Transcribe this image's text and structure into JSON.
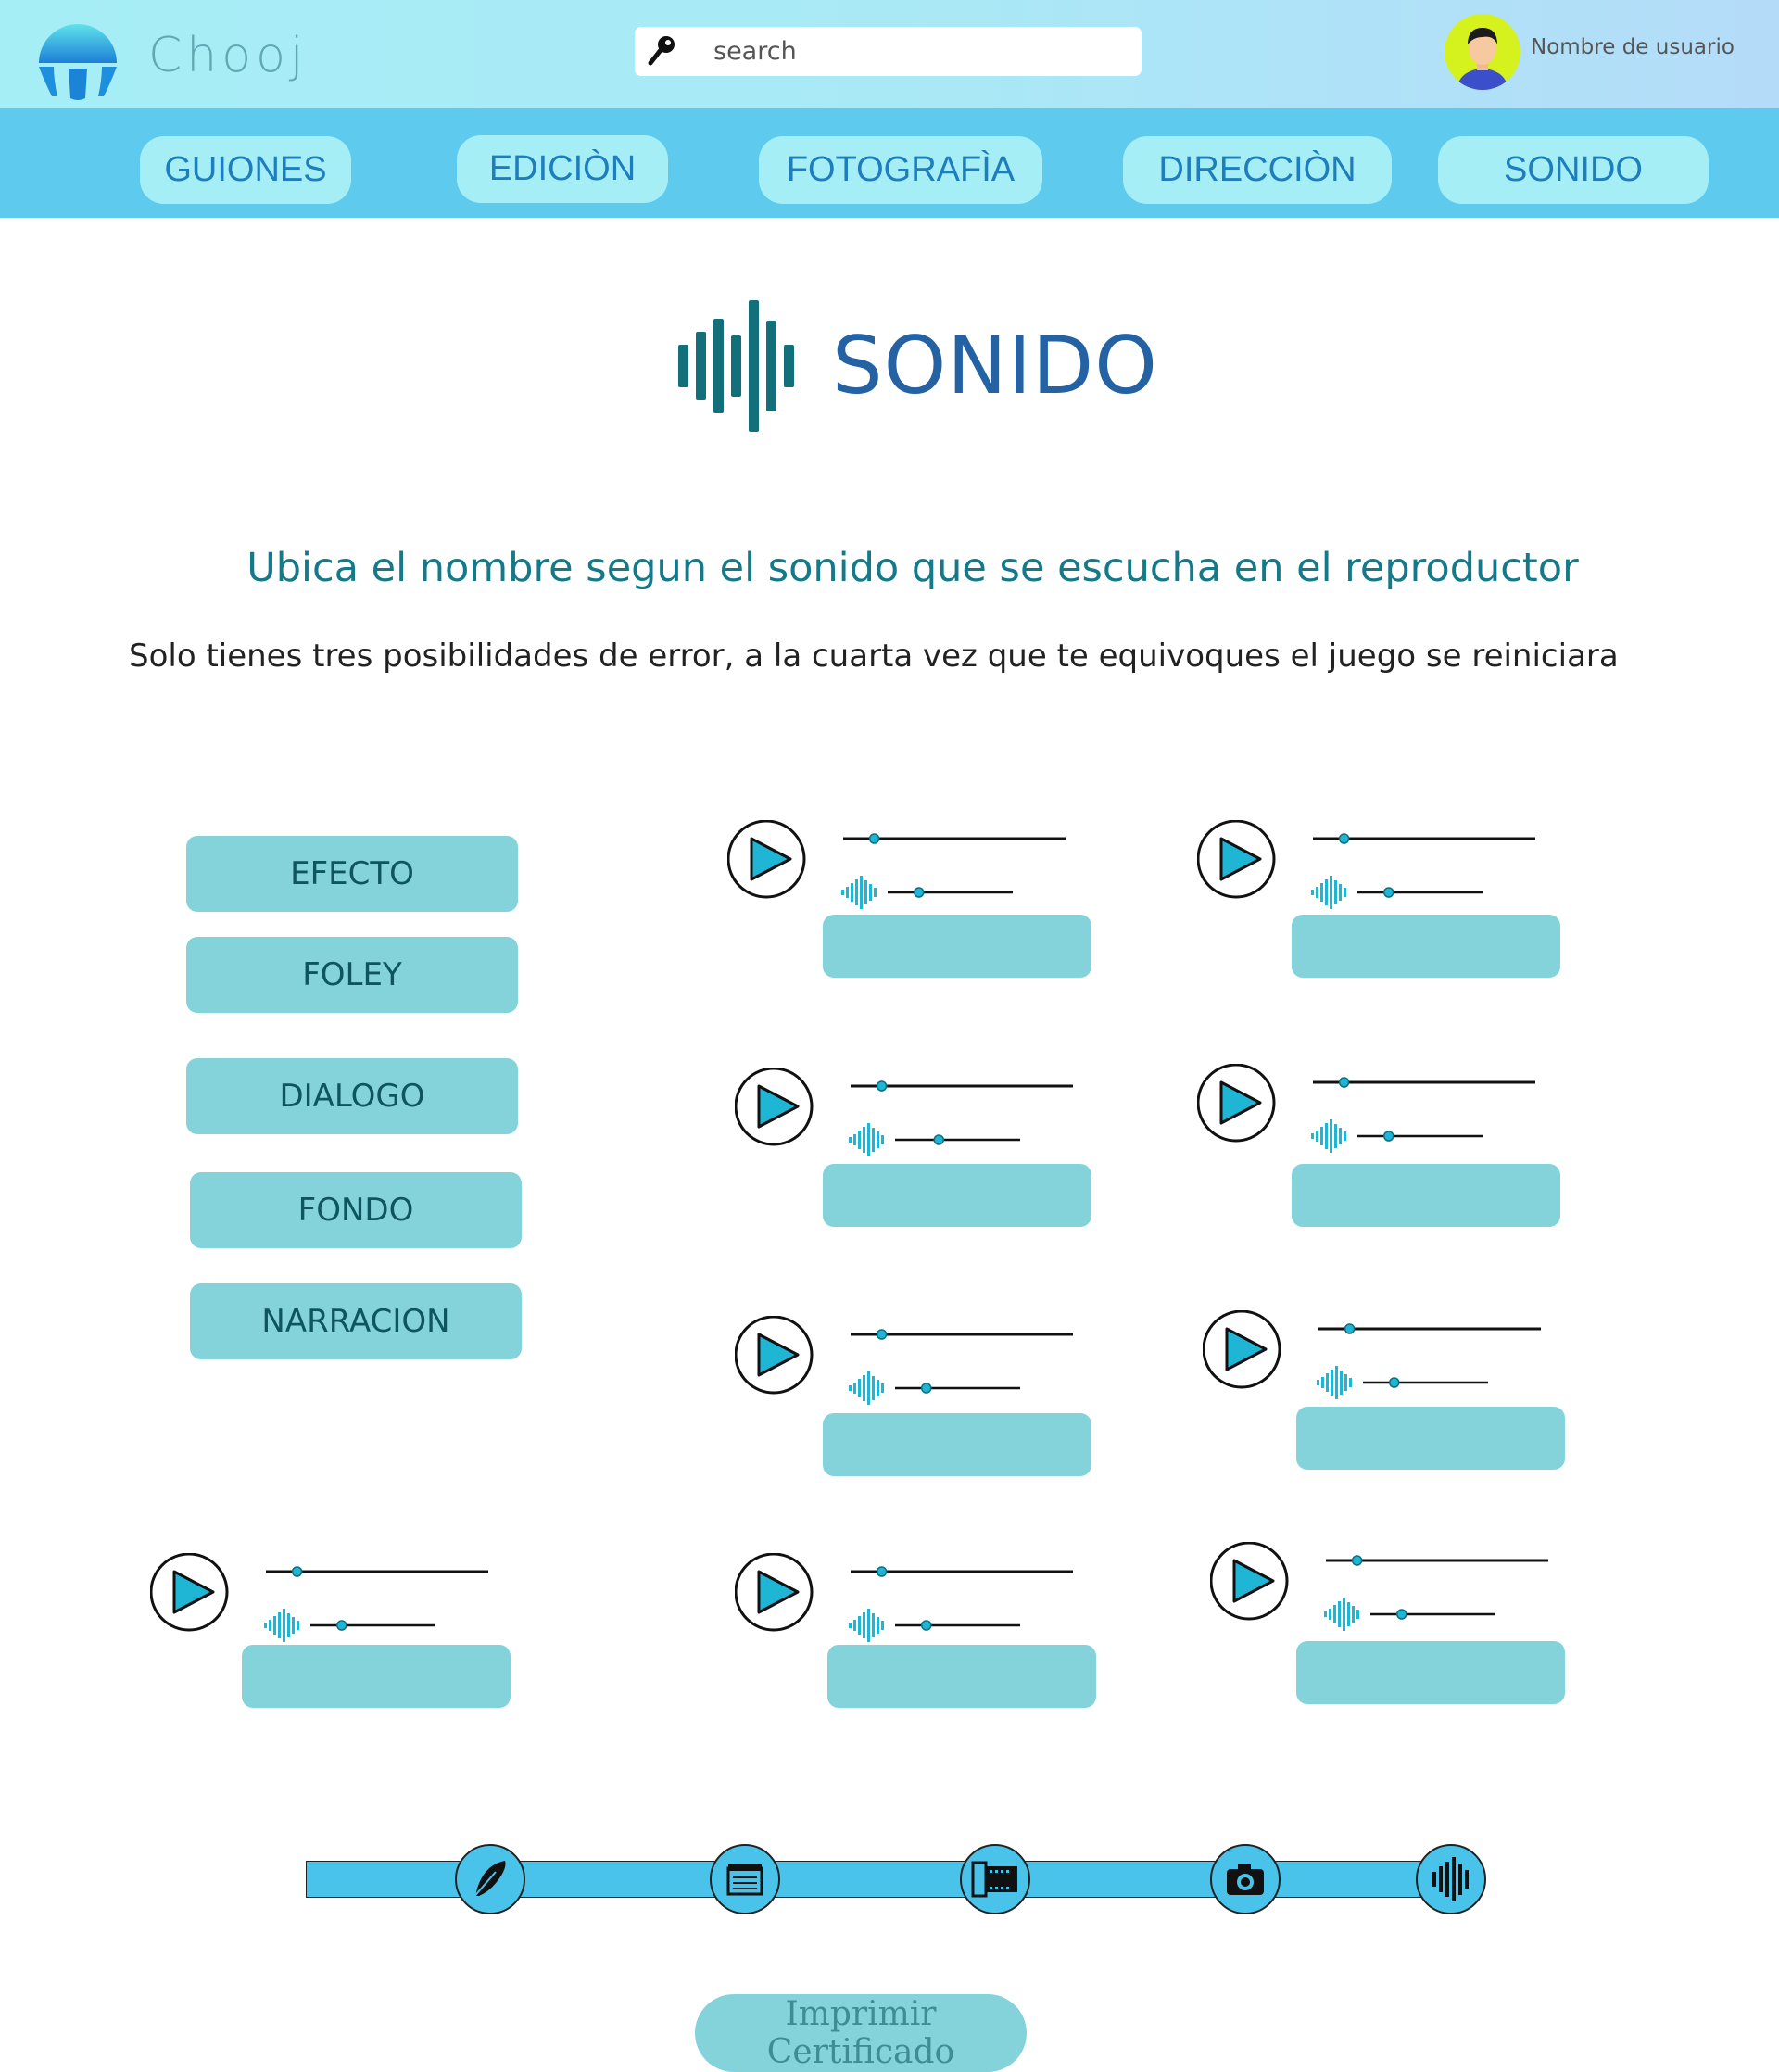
{
  "app": {
    "name": "Chooj"
  },
  "search": {
    "placeholder": "search"
  },
  "user": {
    "name": "Nombre de usuario"
  },
  "nav": {
    "items": [
      {
        "label": "GUIONES"
      },
      {
        "label": "EDICIÒN"
      },
      {
        "label": "FOTOGRAFÌA"
      },
      {
        "label": "DIRECCIÒN"
      },
      {
        "label": "SONIDO"
      }
    ]
  },
  "section": {
    "title": "SONIDO",
    "instruction": "Ubica el nombre segun el sonido que se escucha en el reproductor",
    "rules": "Solo tienes tres posibilidades de error, a la cuarta vez que te equivoques el juego se reiniciara"
  },
  "words": [
    {
      "label": "EFECTO"
    },
    {
      "label": "FOLEY"
    },
    {
      "label": "DIALOGO"
    },
    {
      "label": "FONDO"
    },
    {
      "label": "NARRACION"
    }
  ],
  "players": [
    {
      "progress": 0.14,
      "volume": 0.25
    },
    {
      "progress": 0.14,
      "volume": 0.25
    },
    {
      "progress": 0.14,
      "volume": 0.35
    },
    {
      "progress": 0.14,
      "volume": 0.25
    },
    {
      "progress": 0.14,
      "volume": 0.25
    },
    {
      "progress": 0.14,
      "volume": 0.25
    },
    {
      "progress": 0.14,
      "volume": 0.25
    },
    {
      "progress": 0.14,
      "volume": 0.25
    },
    {
      "progress": 0.14,
      "volume": 0.25
    }
  ],
  "progress_steps": [
    {
      "icon": "feather-icon"
    },
    {
      "icon": "clapperboard-icon"
    },
    {
      "icon": "film-strip-icon"
    },
    {
      "icon": "camera-icon"
    },
    {
      "icon": "sound-wave-icon"
    }
  ],
  "actions": {
    "print_label": "Imprimir Certificado"
  },
  "colors": {
    "header_gradient_start": "#a6eef6",
    "nav_bg": "#5ecaed",
    "nav_button": "#a6eef6",
    "nav_text": "#1e7ebd",
    "title": "#2462a3",
    "icon_teal": "#136f7a",
    "chip": "#84d3db",
    "play_accent": "#1fb6d6"
  }
}
